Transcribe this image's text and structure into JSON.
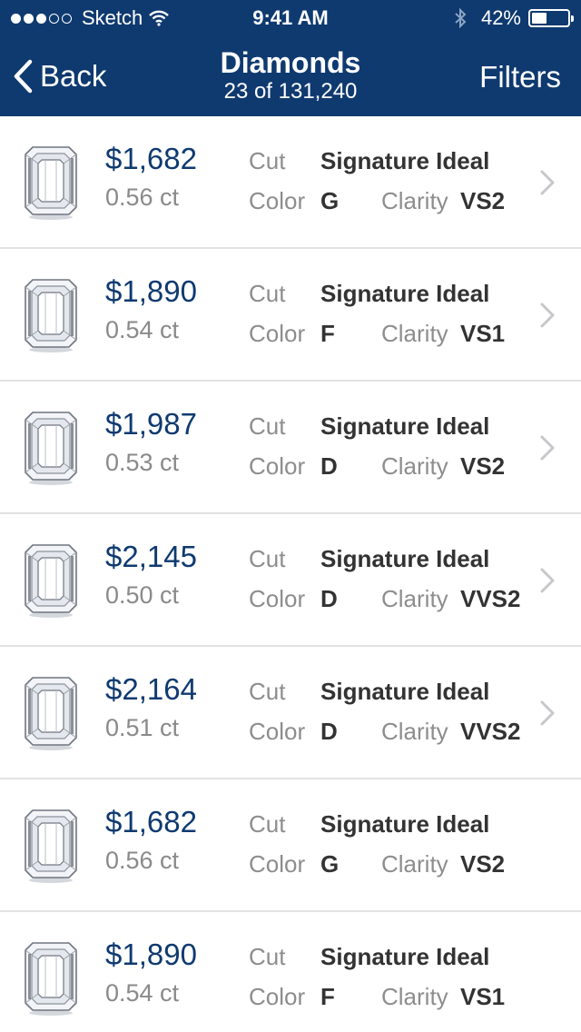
{
  "status_bar": {
    "carrier": "Sketch",
    "time": "9:41 AM",
    "battery_percent": "42%",
    "battery_level": 0.42,
    "signal_dots_filled": 3,
    "signal_dots_total": 5
  },
  "nav": {
    "back_label": "Back",
    "title": "Diamonds",
    "subtitle": "23 of 131,240",
    "filters_label": "Filters"
  },
  "labels": {
    "cut": "Cut",
    "color": "Color",
    "clarity": "Clarity"
  },
  "colors": {
    "brand_navy": "#0f3a70",
    "price_blue": "#0f3a70",
    "label_gray": "#8d8d8d",
    "value_dark": "#333333",
    "divider": "#e2e2e2"
  },
  "diamonds": [
    {
      "price": "$1,682",
      "carat": "0.56 ct",
      "cut": "Signature Ideal",
      "color": "G",
      "clarity": "VS2",
      "chevron": true
    },
    {
      "price": "$1,890",
      "carat": "0.54 ct",
      "cut": "Signature Ideal",
      "color": "F",
      "clarity": "VS1",
      "chevron": true
    },
    {
      "price": "$1,987",
      "carat": "0.53 ct",
      "cut": "Signature Ideal",
      "color": "D",
      "clarity": "VS2",
      "chevron": true
    },
    {
      "price": "$2,145",
      "carat": "0.50 ct",
      "cut": "Signature Ideal",
      "color": "D",
      "clarity": "VVS2",
      "chevron": true
    },
    {
      "price": "$2,164",
      "carat": "0.51 ct",
      "cut": "Signature Ideal",
      "color": "D",
      "clarity": "VVS2",
      "chevron": true
    },
    {
      "price": "$1,682",
      "carat": "0.56 ct",
      "cut": "Signature Ideal",
      "color": "G",
      "clarity": "VS2",
      "chevron": false
    },
    {
      "price": "$1,890",
      "carat": "0.54 ct",
      "cut": "Signature Ideal",
      "color": "F",
      "clarity": "VS1",
      "chevron": false
    }
  ],
  "icons": {
    "back": "chevron-left-icon",
    "row_disclosure": "chevron-right-icon",
    "diamond": "emerald-cut-diamond-icon",
    "wifi": "wifi-icon",
    "bluetooth": "bluetooth-icon",
    "battery": "battery-icon"
  }
}
